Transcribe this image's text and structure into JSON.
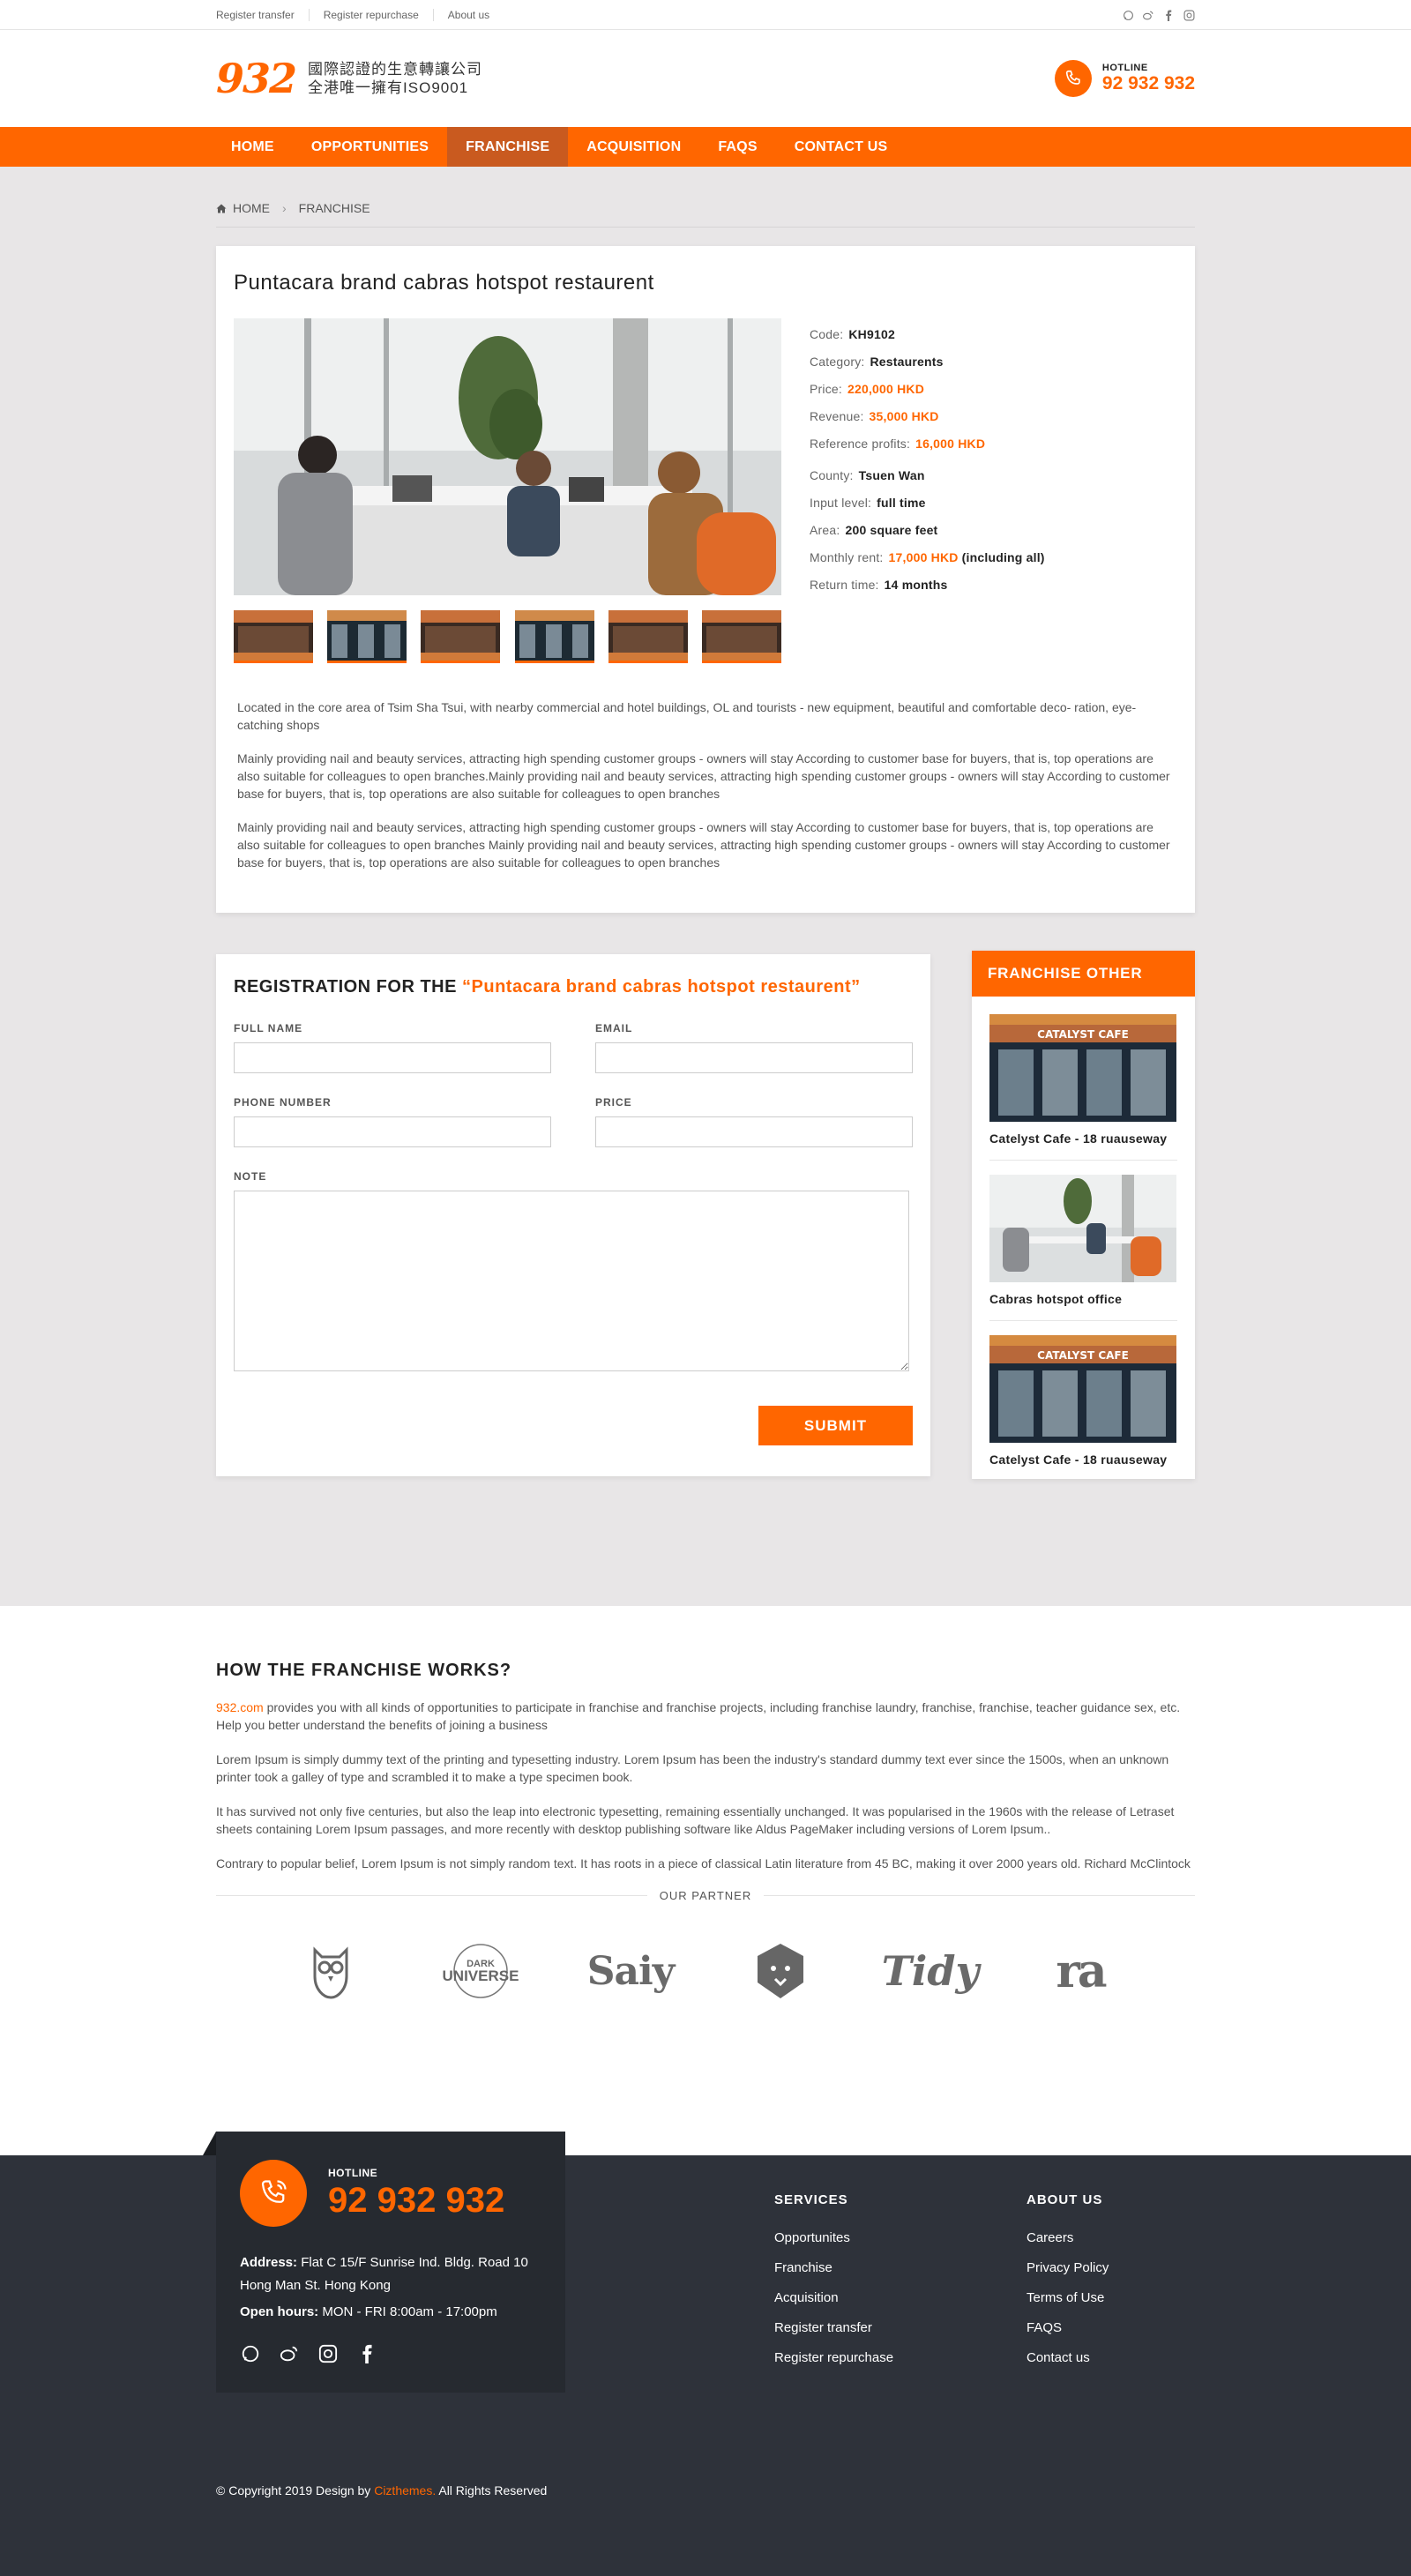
{
  "topbar": {
    "links": [
      "Register transfer",
      "Register repurchase",
      "About us"
    ]
  },
  "header": {
    "logo_num": "932",
    "logo_line1": "國際認證的生意轉讓公司",
    "logo_line2": "全港唯一擁有ISO9001",
    "hotline_label": "HOTLINE",
    "hotline_number": "92 932 932"
  },
  "nav": {
    "items": [
      "HOME",
      "OPPORTUNITIES",
      "FRANCHISE",
      "ACQUISITION",
      "FAQS",
      "CONTACT US"
    ],
    "active": "FRANCHISE"
  },
  "breadcrumb": {
    "home": "HOME",
    "current": "FRANCHISE"
  },
  "listing": {
    "title": "Puntacara brand cabras hotspot restaurent",
    "specs": {
      "code_label": "Code:",
      "code": "KH9102",
      "category_label": "Category:",
      "category": "Restaurents",
      "price_label": "Price:",
      "price": "220,000 HKD",
      "revenue_label": "Revenue:",
      "revenue": "35,000 HKD",
      "profits_label": "Reference profits:",
      "profits": "16,000 HKD",
      "county_label": "County:",
      "county": "Tsuen Wan",
      "input_label": "Input level:",
      "input": "full time",
      "area_label": "Area:",
      "area": "200 square feet",
      "rent_label": "Monthly rent:",
      "rent": "17,000 HKD",
      "rent_note": "(including all)",
      "return_label": "Return time:",
      "return": "14 months"
    },
    "desc": [
      "Located in the core area of Tsim Sha Tsui, with nearby commercial and hotel buildings, OL and tourists - new equipment, beautiful and comfortable deco- ration, eye-catching shops",
      "Mainly providing nail and beauty services, attracting high spending customer groups - owners will stay According to customer base for buyers, that is, top operations are also suitable for colleagues to open branches.Mainly providing nail and beauty services, attracting high spending customer groups - owners will stay According to customer base for buyers, that is, top operations are also suitable for colleagues to open branches",
      "Mainly providing nail and beauty services, attracting high spending customer groups - owners will stay According to customer base for buyers, that is, top operations are also suitable for colleagues to open branches Mainly providing nail and beauty services, attracting high spending customer groups - owners will stay According to customer base for buyers, that is, top operations are also suitable for colleagues to open branches"
    ]
  },
  "form": {
    "title_prefix": "REGISTRATION FOR THE",
    "title_quote": "“Puntacara brand cabras hotspot restaurent”",
    "full_name": "FULL NAME",
    "email": "EMAIL",
    "phone": "PHONE NUMBER",
    "price": "PRICE",
    "note": "NOTE",
    "submit": "SUBMIT"
  },
  "sidebar": {
    "title": "FRANCHISE OTHER",
    "items": [
      "Catelyst Cafe - 18 ruauseway",
      "Cabras hotspot office",
      "Catelyst Cafe - 18 ruauseway"
    ],
    "cafe_sign": "CATALYST CAFE"
  },
  "how": {
    "title": "HOW THE FRANCHISE WORKS?",
    "site": "932.com",
    "p1": " provides you with all kinds of opportunities to participate in franchise and franchise projects, including franchise laundry, franchise, franchise, teacher guidance sex, etc. Help you better understand the benefits of joining a business",
    "p2": "Lorem Ipsum is simply dummy text of the printing and typesetting industry. Lorem Ipsum has been the industry's standard dummy text ever since the 1500s, when an unknown printer took a galley of type and scrambled it to make a type specimen book.",
    "p3": "It has survived not only five centuries, but also the leap into electronic typesetting, remaining essentially unchanged. It was popularised in the 1960s with the release of Letraset sheets containing Lorem Ipsum passages, and more recently with desktop publishing software like Aldus PageMaker including versions of Lorem Ipsum..",
    "p4": "Contrary to popular belief, Lorem Ipsum is not simply random text. It has roots in a piece of classical Latin literature from 45 BC, making it over 2000 years old. Richard McClintock",
    "partner_label": "OUR PARTNER",
    "partners": [
      "DARK",
      "UNIVERSE",
      "Saiy",
      "Tidy",
      "ra"
    ]
  },
  "footer": {
    "hotline_label": "HOTLINE",
    "hotline_number": "92 932 932",
    "address_label": "Address:",
    "address": "Flat C 15/F Sunrise Ind. Bldg.  Road 10 Hong Man St. Hong Kong",
    "hours_label": "Open hours:",
    "hours": "MON - FRI  8:00am - 17:00pm",
    "services_title": "SERVICES",
    "services": [
      "Opportunites",
      "Franchise",
      "Acquisition",
      "Register transfer",
      "Register repurchase"
    ],
    "about_title": "ABOUT US",
    "about": [
      "Careers",
      "Privacy Policy",
      "Terms of Use",
      "FAQS",
      "Contact us"
    ],
    "copy_prefix": "© Copyright 2019 Design by",
    "copy_brand": "Cizthemes.",
    "copy_suffix": "All Rights Reserved"
  },
  "colors": {
    "accent": "#ff6600",
    "footer_bg": "#2e323a",
    "main_bg": "#e8e6e7"
  }
}
